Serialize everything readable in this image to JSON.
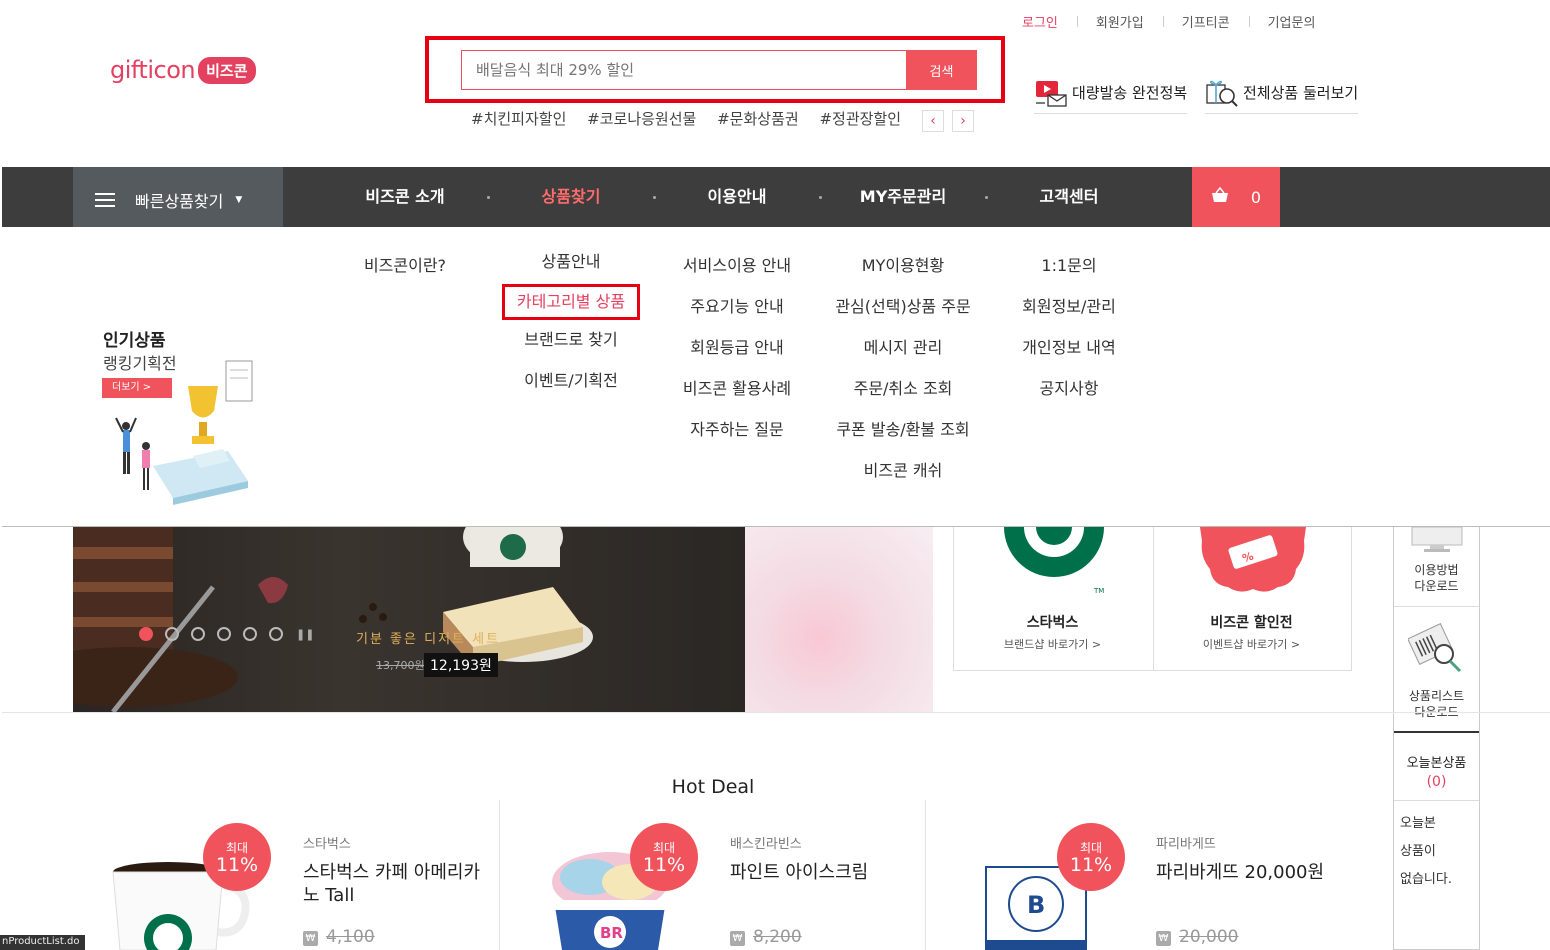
{
  "logo": {
    "word": "gifticon",
    "badge": "비즈콘"
  },
  "search": {
    "placeholder": "배달음식 최대 29% 할인",
    "button": "검색"
  },
  "hashtags": [
    "#치킨피자할인",
    "#코로나응원선물",
    "#문화상품권",
    "#정관장할인"
  ],
  "util_links": [
    "로그인",
    "회원가입",
    "기프티콘",
    "기업문의"
  ],
  "shortcuts": {
    "bulk": "대량발송 완전정복",
    "all_products": "전체상품 둘러보기"
  },
  "gnb": {
    "quick_find": "빠른상품찾기",
    "menus": [
      "비즈콘 소개",
      "상품찾기",
      "이용안내",
      "MY주문관리",
      "고객센터"
    ],
    "cart_count": "0"
  },
  "dropdown": {
    "intro": [
      "비즈콘이란?"
    ],
    "products": [
      "상품안내",
      "카테고리별 상품",
      "브랜드로 찾기",
      "이벤트/기획전"
    ],
    "guide": [
      "서비스이용 안내",
      "주요기능 안내",
      "회원등급 안내",
      "비즈콘 활용사례",
      "자주하는 질문"
    ],
    "my": [
      "MY이용현황",
      "관심(선택)상품 주문",
      "메시지 관리",
      "주문/취소 조회",
      "쿠폰 발송/환불 조회",
      "비즈콘 캐쉬"
    ],
    "cs": [
      "1:1문의",
      "회원정보/관리",
      "개인정보 내역",
      "공지사항"
    ],
    "promo": {
      "title": "인기상품",
      "subtitle": "랭킹기획전",
      "more": "더보기  >"
    }
  },
  "banner": {
    "caption": "기분 좋은 디저트 세트",
    "old_price": "13,700원",
    "new_price": "12,193원"
  },
  "brands": [
    {
      "title": "스타벅스",
      "link": "브랜드샵 바로가기 >"
    },
    {
      "title": "비즈콘 할인전",
      "link": "이벤트샵 바로가기 >"
    }
  ],
  "sidebar": {
    "guide_download": [
      "이용방법",
      "다운로드"
    ],
    "list_download": [
      "상품리스트",
      "다운로드"
    ],
    "today_title": "오늘본상품",
    "today_count": "(0)",
    "today_empty": [
      "오늘본",
      "상품이",
      "없습니다."
    ]
  },
  "hot_deal": {
    "title": "Hot Deal",
    "products": [
      {
        "brand": "스타벅스",
        "name": "스타벅스 카페 아메리카노 Tall",
        "price": "4,100",
        "badge_top": "최대",
        "badge_pct": "11%"
      },
      {
        "brand": "배스킨라빈스",
        "name": "파인트 아이스크림",
        "price": "8,200",
        "badge_top": "최대",
        "badge_pct": "11%"
      },
      {
        "brand": "파리바게뜨",
        "name": "파리바게뜨 20,000원",
        "price": "20,000",
        "badge_top": "최대",
        "badge_pct": "11%"
      }
    ]
  },
  "status_url": "nProductList.do",
  "colors": {
    "accent": "#f0535b",
    "highlight": "#e60012",
    "nav_bg": "#3d3d3d"
  }
}
